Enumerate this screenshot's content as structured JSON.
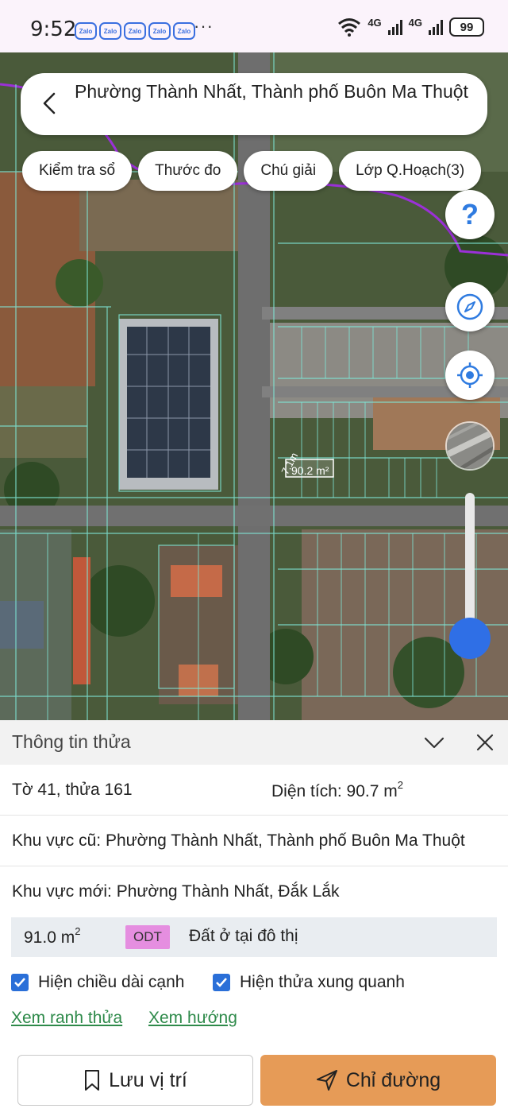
{
  "status_bar": {
    "time": "9:52",
    "notification_icons": [
      "Zalo",
      "Zalo",
      "Zalo",
      "Zalo",
      "Zalo"
    ],
    "more": "···",
    "network_1": "4G",
    "network_2": "4G",
    "battery": "99"
  },
  "header": {
    "title": "Phường Thành Nhất, Thành phố Buôn Ma Thuột"
  },
  "chips": [
    {
      "label": "Kiểm tra sổ"
    },
    {
      "label": "Thước đo"
    },
    {
      "label": "Chú giải"
    },
    {
      "label": "Lớp Q.Hoạch(3)"
    }
  ],
  "map": {
    "parcel_edge_label": "7.1m",
    "parcel_area_label": "90.2 m²",
    "zoom_level_fraction": 0.1
  },
  "panel": {
    "title": "Thông tin thửa",
    "parcel_id": "Tờ 41, thửa 161",
    "area_label": "Diện tích: 90.7 m",
    "area_sup": "2",
    "old_area": "Khu vực cũ: Phường Thành Nhất, Thành phố Buôn Ma Thuột",
    "new_area": "Khu vực mới: Phường Thành Nhất, Đắk Lắk",
    "landuse": {
      "area": "91.0 m",
      "area_sup": "2",
      "code": "ODT",
      "name": "Đất ở tại đô thị",
      "code_color": "#e58ee0"
    },
    "checkboxes": [
      {
        "label": "Hiện chiều dài cạnh",
        "checked": true
      },
      {
        "label": "Hiện thửa xung quanh",
        "checked": true
      }
    ],
    "links": [
      {
        "label": "Xem ranh thửa"
      },
      {
        "label": "Xem hướng"
      }
    ],
    "save_button": "Lưu vị trí",
    "route_button": "Chỉ đường"
  },
  "colors": {
    "accent": "#2f6fe6",
    "route_button": "#e69b57",
    "link": "#2e8a4a",
    "parcel_lines": "#7fe8d8",
    "boundary": "#9b30d8"
  },
  "icons": [
    "back-icon",
    "help-icon",
    "compass-icon",
    "locate-icon",
    "layer-icon",
    "collapse-icon",
    "close-icon",
    "bookmark-icon",
    "send-icon",
    "checkbox-icon",
    "wifi-icon"
  ]
}
